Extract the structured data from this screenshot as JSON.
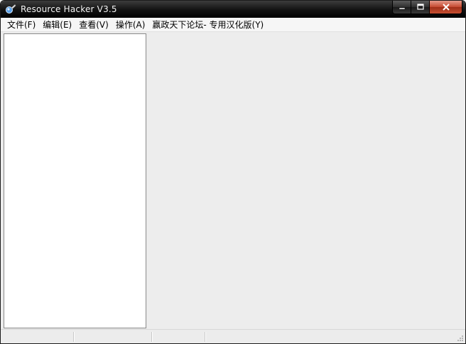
{
  "window": {
    "title": "Resource Hacker V3.5",
    "icon": "resource-hacker-app-icon"
  },
  "caption": {
    "minimize_icon": "minimize-icon",
    "maximize_icon": "maximize-icon",
    "close_icon": "close-icon"
  },
  "menu": {
    "items": [
      {
        "label": "文件(F)"
      },
      {
        "label": "编辑(E)"
      },
      {
        "label": "查看(V)"
      },
      {
        "label": "操作(A)"
      },
      {
        "label": "赢政天下论坛- 专用汉化版(Y)"
      }
    ]
  },
  "colors": {
    "titlebar": "#000000",
    "close_button": "#c5482f",
    "client_background": "#ececec",
    "tree_background": "#ffffff"
  }
}
